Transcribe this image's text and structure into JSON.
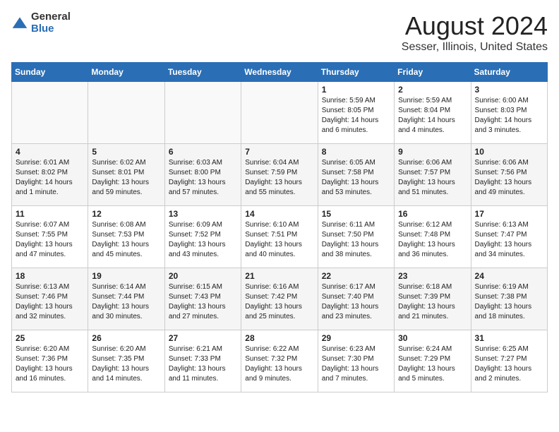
{
  "header": {
    "logo_general": "General",
    "logo_blue": "Blue",
    "title": "August 2024",
    "subtitle": "Sesser, Illinois, United States"
  },
  "calendar": {
    "days_of_week": [
      "Sunday",
      "Monday",
      "Tuesday",
      "Wednesday",
      "Thursday",
      "Friday",
      "Saturday"
    ],
    "weeks": [
      [
        {
          "day": "",
          "info": ""
        },
        {
          "day": "",
          "info": ""
        },
        {
          "day": "",
          "info": ""
        },
        {
          "day": "",
          "info": ""
        },
        {
          "day": "1",
          "info": "Sunrise: 5:59 AM\nSunset: 8:05 PM\nDaylight: 14 hours and 6 minutes."
        },
        {
          "day": "2",
          "info": "Sunrise: 5:59 AM\nSunset: 8:04 PM\nDaylight: 14 hours and 4 minutes."
        },
        {
          "day": "3",
          "info": "Sunrise: 6:00 AM\nSunset: 8:03 PM\nDaylight: 14 hours and 3 minutes."
        }
      ],
      [
        {
          "day": "4",
          "info": "Sunrise: 6:01 AM\nSunset: 8:02 PM\nDaylight: 14 hours and 1 minute."
        },
        {
          "day": "5",
          "info": "Sunrise: 6:02 AM\nSunset: 8:01 PM\nDaylight: 13 hours and 59 minutes."
        },
        {
          "day": "6",
          "info": "Sunrise: 6:03 AM\nSunset: 8:00 PM\nDaylight: 13 hours and 57 minutes."
        },
        {
          "day": "7",
          "info": "Sunrise: 6:04 AM\nSunset: 7:59 PM\nDaylight: 13 hours and 55 minutes."
        },
        {
          "day": "8",
          "info": "Sunrise: 6:05 AM\nSunset: 7:58 PM\nDaylight: 13 hours and 53 minutes."
        },
        {
          "day": "9",
          "info": "Sunrise: 6:06 AM\nSunset: 7:57 PM\nDaylight: 13 hours and 51 minutes."
        },
        {
          "day": "10",
          "info": "Sunrise: 6:06 AM\nSunset: 7:56 PM\nDaylight: 13 hours and 49 minutes."
        }
      ],
      [
        {
          "day": "11",
          "info": "Sunrise: 6:07 AM\nSunset: 7:55 PM\nDaylight: 13 hours and 47 minutes."
        },
        {
          "day": "12",
          "info": "Sunrise: 6:08 AM\nSunset: 7:53 PM\nDaylight: 13 hours and 45 minutes."
        },
        {
          "day": "13",
          "info": "Sunrise: 6:09 AM\nSunset: 7:52 PM\nDaylight: 13 hours and 43 minutes."
        },
        {
          "day": "14",
          "info": "Sunrise: 6:10 AM\nSunset: 7:51 PM\nDaylight: 13 hours and 40 minutes."
        },
        {
          "day": "15",
          "info": "Sunrise: 6:11 AM\nSunset: 7:50 PM\nDaylight: 13 hours and 38 minutes."
        },
        {
          "day": "16",
          "info": "Sunrise: 6:12 AM\nSunset: 7:48 PM\nDaylight: 13 hours and 36 minutes."
        },
        {
          "day": "17",
          "info": "Sunrise: 6:13 AM\nSunset: 7:47 PM\nDaylight: 13 hours and 34 minutes."
        }
      ],
      [
        {
          "day": "18",
          "info": "Sunrise: 6:13 AM\nSunset: 7:46 PM\nDaylight: 13 hours and 32 minutes."
        },
        {
          "day": "19",
          "info": "Sunrise: 6:14 AM\nSunset: 7:44 PM\nDaylight: 13 hours and 30 minutes."
        },
        {
          "day": "20",
          "info": "Sunrise: 6:15 AM\nSunset: 7:43 PM\nDaylight: 13 hours and 27 minutes."
        },
        {
          "day": "21",
          "info": "Sunrise: 6:16 AM\nSunset: 7:42 PM\nDaylight: 13 hours and 25 minutes."
        },
        {
          "day": "22",
          "info": "Sunrise: 6:17 AM\nSunset: 7:40 PM\nDaylight: 13 hours and 23 minutes."
        },
        {
          "day": "23",
          "info": "Sunrise: 6:18 AM\nSunset: 7:39 PM\nDaylight: 13 hours and 21 minutes."
        },
        {
          "day": "24",
          "info": "Sunrise: 6:19 AM\nSunset: 7:38 PM\nDaylight: 13 hours and 18 minutes."
        }
      ],
      [
        {
          "day": "25",
          "info": "Sunrise: 6:20 AM\nSunset: 7:36 PM\nDaylight: 13 hours and 16 minutes."
        },
        {
          "day": "26",
          "info": "Sunrise: 6:20 AM\nSunset: 7:35 PM\nDaylight: 13 hours and 14 minutes."
        },
        {
          "day": "27",
          "info": "Sunrise: 6:21 AM\nSunset: 7:33 PM\nDaylight: 13 hours and 11 minutes."
        },
        {
          "day": "28",
          "info": "Sunrise: 6:22 AM\nSunset: 7:32 PM\nDaylight: 13 hours and 9 minutes."
        },
        {
          "day": "29",
          "info": "Sunrise: 6:23 AM\nSunset: 7:30 PM\nDaylight: 13 hours and 7 minutes."
        },
        {
          "day": "30",
          "info": "Sunrise: 6:24 AM\nSunset: 7:29 PM\nDaylight: 13 hours and 5 minutes."
        },
        {
          "day": "31",
          "info": "Sunrise: 6:25 AM\nSunset: 7:27 PM\nDaylight: 13 hours and 2 minutes."
        }
      ]
    ]
  }
}
